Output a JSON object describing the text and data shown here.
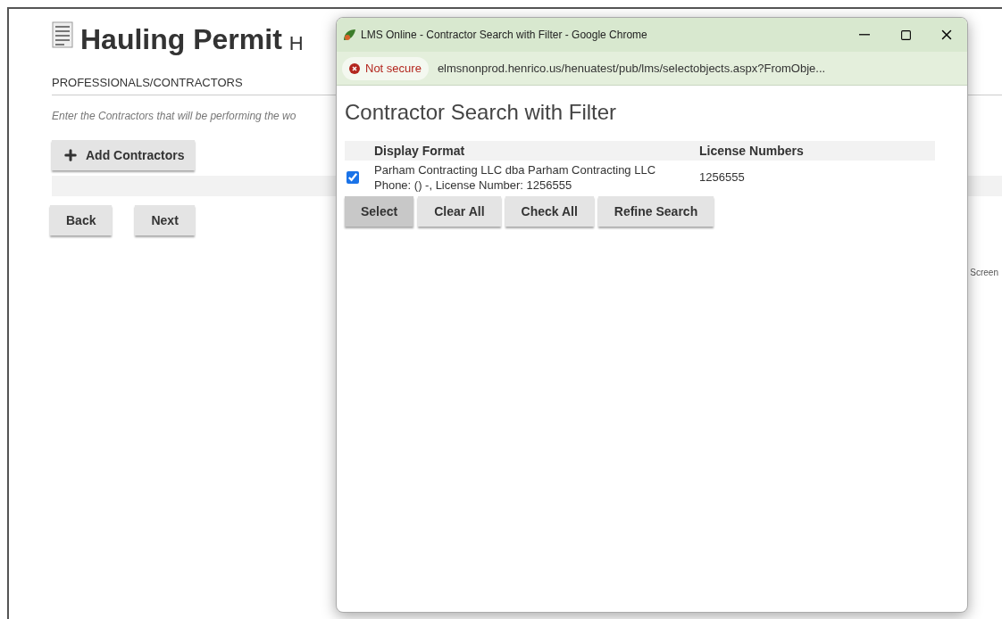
{
  "page": {
    "title": "Hauling Permit",
    "title_suffix": "H",
    "section": "PROFESSIONALS/CONTRACTORS",
    "instructions": "Enter the Contractors that will be performing the wo",
    "add_button": "Add Contractors",
    "buttons": [
      "Back",
      "Next"
    ],
    "side_text": "Screen"
  },
  "popup": {
    "window_title": "LMS Online - Contractor Search with Filter - Google Chrome",
    "security": "Not secure",
    "url": "elmsnonprod.henrico.us/henuatest/pub/lms/selectobjects.aspx?FromObje...",
    "heading": "Contractor Search with Filter",
    "columns": [
      "Display Format",
      "License Numbers"
    ],
    "rows": [
      {
        "checked": true,
        "display": [
          "Parham Contracting LLC dba Parham Contracting LLC",
          "Phone: () -, License Number: 1256555"
        ],
        "license": "1256555"
      }
    ],
    "buttons": [
      {
        "label": "Select",
        "selected": true
      },
      {
        "label": "Clear All",
        "selected": false
      },
      {
        "label": "Check All",
        "selected": false
      },
      {
        "label": "Refine Search",
        "selected": false
      }
    ]
  }
}
